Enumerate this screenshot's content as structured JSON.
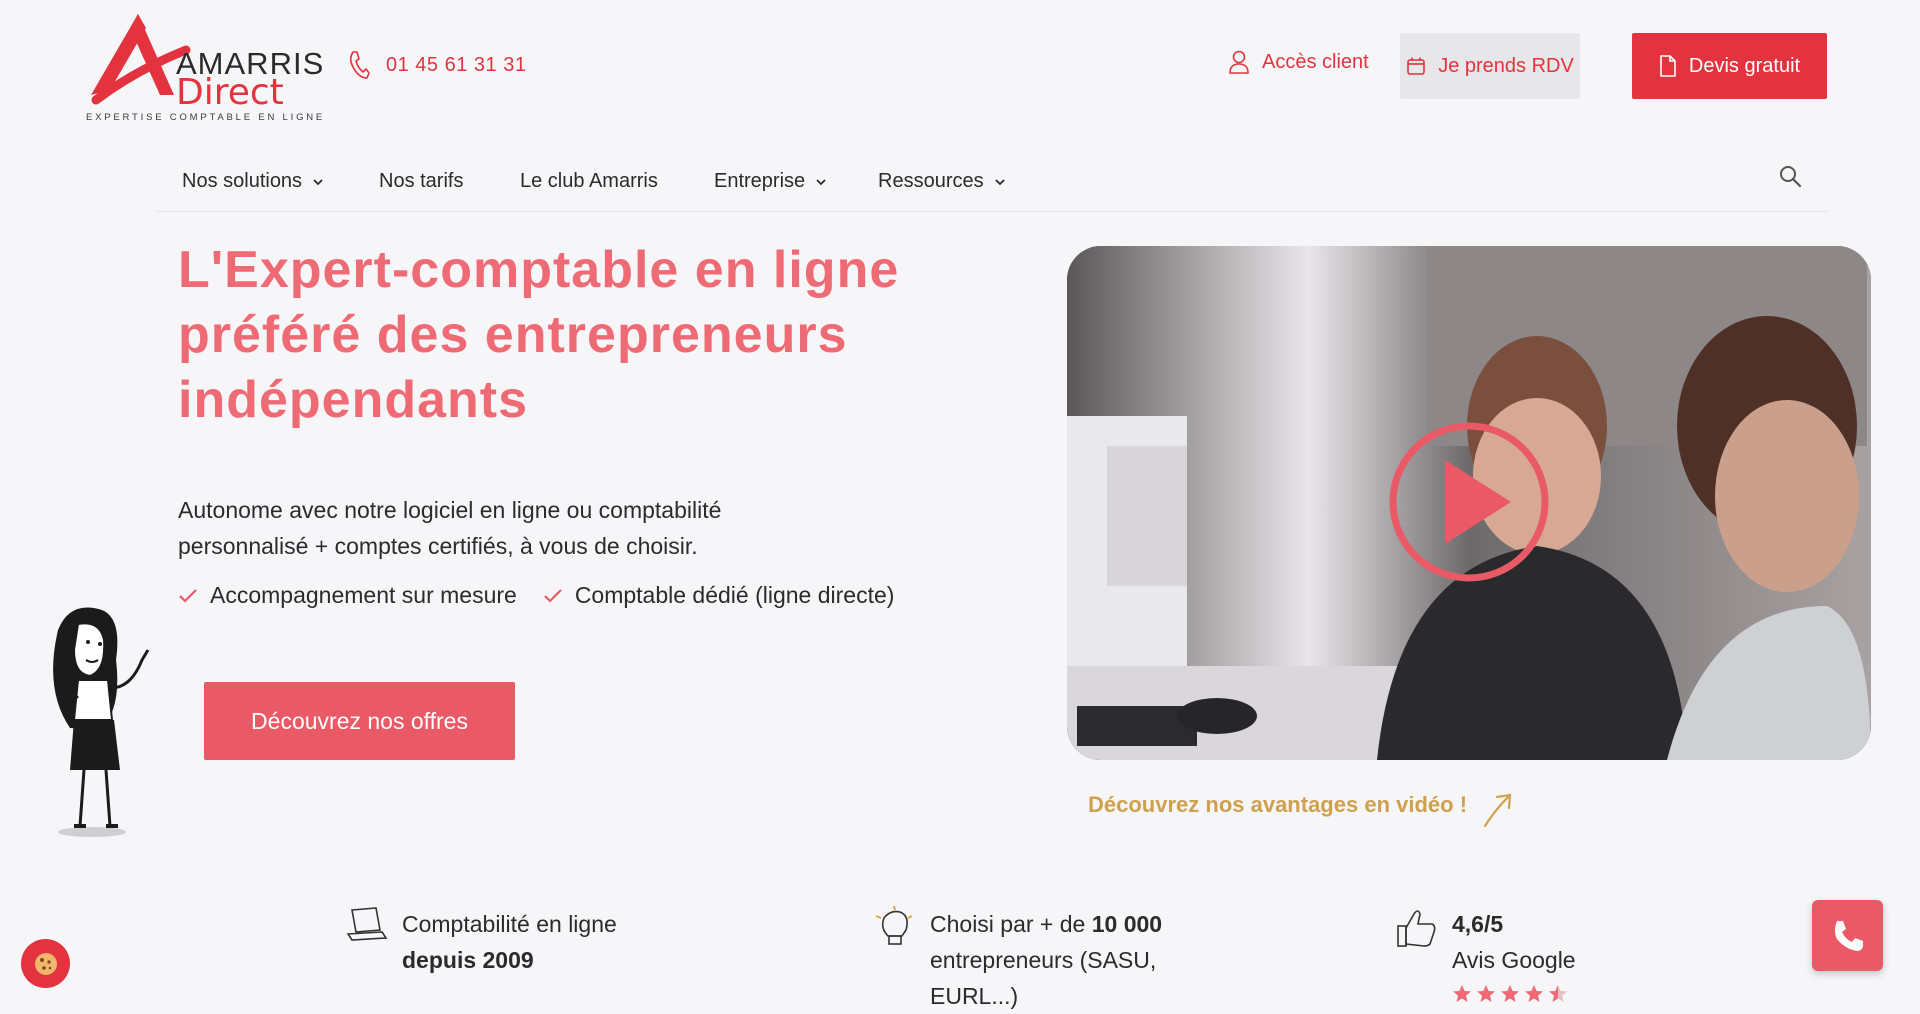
{
  "brand": {
    "logo_word1": "AMARRIS",
    "logo_word2": "Direct",
    "tagline": "EXPERTISE COMPTABLE EN LIGNE",
    "accent": "#e2333f"
  },
  "header": {
    "phone": "01 45 61 31 31",
    "client_access": "Accès client",
    "rdv_button": "Je prends RDV",
    "quote_button": "Devis gratuit"
  },
  "nav": {
    "items": [
      {
        "label": "Nos solutions",
        "dropdown": true
      },
      {
        "label": "Nos tarifs",
        "dropdown": false
      },
      {
        "label": "Le club Amarris",
        "dropdown": false
      },
      {
        "label": "Entreprise",
        "dropdown": true
      },
      {
        "label": "Ressources",
        "dropdown": true
      }
    ]
  },
  "hero": {
    "title": "L'Expert-comptable en ligne préféré des entrepreneurs indépendants",
    "subtitle": "Autonome avec notre logiciel en ligne ou comptabilité personnalisé + comptes certifiés, à vous de choisir.",
    "checks": [
      "Accompagnement sur mesure",
      "Comptable dédié (ligne directe)"
    ],
    "cta": "Découvrez nos offres"
  },
  "video": {
    "caption": "Découvrez nos avantages en vidéo !"
  },
  "stats": [
    {
      "icon": "laptop-icon",
      "line1": "Comptabilité en ligne",
      "line2_bold": "depuis 2009"
    },
    {
      "icon": "lightbulb-icon",
      "prefix": "Choisi par + de ",
      "bold": "10 000",
      "line2": "entrepreneurs (SASU,",
      "line3": "EURL...)"
    },
    {
      "icon": "thumbs-up-icon",
      "rating": "4,6/5",
      "label": "Avis Google",
      "stars": 4.5
    }
  ]
}
